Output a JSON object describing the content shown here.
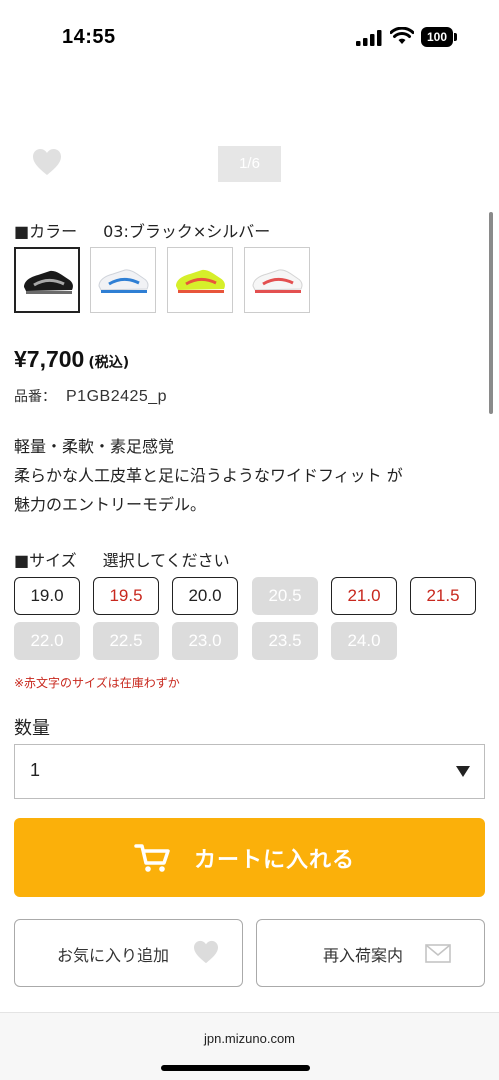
{
  "status_bar": {
    "time": "14:55",
    "battery": "100",
    "icons": [
      "signal-icon",
      "wifi-icon",
      "battery-icon"
    ]
  },
  "gallery": {
    "pager": "1/6",
    "favorite_icon": "heart-icon"
  },
  "color": {
    "label": "■カラー",
    "selected": "03:ブラック×シルバー",
    "swatches": [
      {
        "name": "black-silver",
        "colors": [
          "#1a1a1a",
          "#9a9a9a"
        ]
      },
      {
        "name": "white-blue",
        "colors": [
          "#f4f4f6",
          "#2f7fd4"
        ]
      },
      {
        "name": "yellow-red",
        "colors": [
          "#d6ef2a",
          "#e8553b"
        ]
      },
      {
        "name": "white-red",
        "colors": [
          "#f6f6f6",
          "#e35050"
        ]
      }
    ]
  },
  "price": {
    "amount": "¥7,700",
    "tax": "(税込)"
  },
  "sku": {
    "label": "品番：",
    "value": "P1GB2425_p"
  },
  "description": [
    "軽量・柔軟・素足感覚",
    "柔らかな人工皮革と足に沿うようなワイドフィット が",
    "魅力のエントリーモデル。"
  ],
  "size": {
    "label": "■サイズ",
    "prompt": "選択してください",
    "options": [
      {
        "value": "19.0",
        "status": "in"
      },
      {
        "value": "19.5",
        "status": "low"
      },
      {
        "value": "20.0",
        "status": "in"
      },
      {
        "value": "20.5",
        "status": "out"
      },
      {
        "value": "21.0",
        "status": "low"
      },
      {
        "value": "21.5",
        "status": "low"
      },
      {
        "value": "22.0",
        "status": "out"
      },
      {
        "value": "22.5",
        "status": "out"
      },
      {
        "value": "23.0",
        "status": "out"
      },
      {
        "value": "23.5",
        "status": "out"
      },
      {
        "value": "24.0",
        "status": "out"
      }
    ],
    "note": "※赤文字のサイズは在庫わずか"
  },
  "quantity": {
    "label": "数量",
    "value": "1"
  },
  "actions": {
    "cart": "カートに入れる",
    "wishlist": "お気に入り追加",
    "restock": "再入荷案内"
  },
  "browser": {
    "url": "jpn.mizuno.com"
  },
  "colors": {
    "accent": "#fbb00a",
    "low_stock": "#c8281e",
    "sold_out": "#dcdcdc"
  }
}
